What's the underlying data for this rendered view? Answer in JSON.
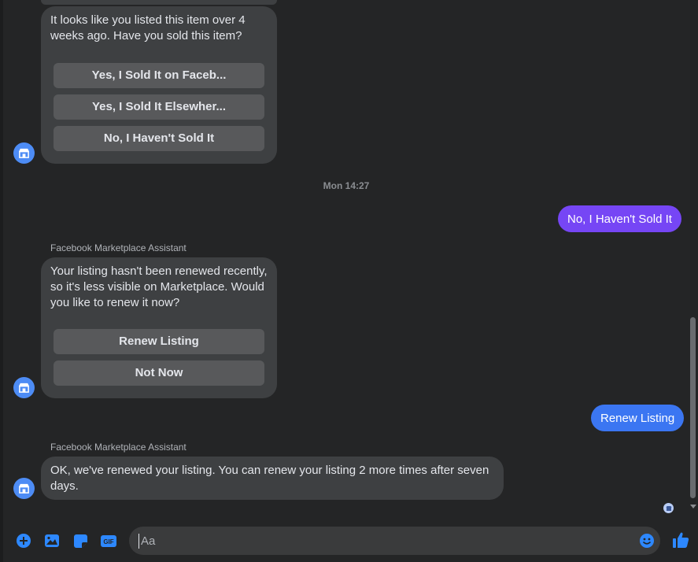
{
  "messages": {
    "first": {
      "text": "It looks like you listed this item over 4 weeks ago. Have you sold this item?",
      "buttons": [
        "Yes, I Sold It on Faceb...",
        "Yes, I Sold It Elsewher...",
        "No, I Haven't Sold It"
      ]
    },
    "timestamp": "Mon 14:27",
    "reply1": "No, I Haven't Sold It",
    "second": {
      "sender": "Facebook Marketplace Assistant",
      "text": "Your listing hasn't been renewed recently, so it's less visible on Marketplace. Would you like to renew it now?",
      "buttons": [
        "Renew Listing",
        "Not Now"
      ]
    },
    "reply2": "Renew Listing",
    "third": {
      "sender": "Facebook Marketplace Assistant",
      "text": "OK, we've renewed your listing. You can renew your listing 2 more times after seven days."
    }
  },
  "composer": {
    "placeholder": "Aa",
    "tools": [
      "plus-icon",
      "image-icon",
      "sticker-icon",
      "gif-icon"
    ],
    "gif_label": "GIF"
  },
  "colors": {
    "background": "#242526",
    "incoming_bubble": "#3e4042",
    "quick_reply": "#58595b",
    "reply1_bubble": "#7646f5",
    "reply2_bubble": "#3b76f2",
    "accent": "#2d88ff"
  }
}
